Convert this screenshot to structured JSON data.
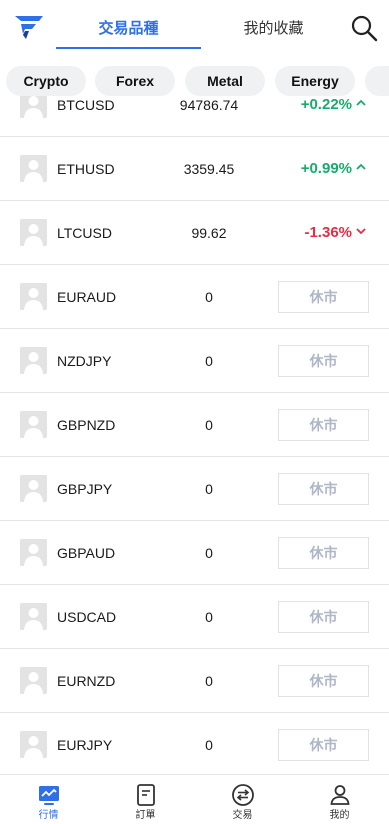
{
  "header": {
    "logo": "app-logo",
    "tabs": [
      {
        "label": "交易品種",
        "active": true
      },
      {
        "label": "我的收藏",
        "active": false
      }
    ],
    "search_icon": "search-icon"
  },
  "categories": [
    "Crypto",
    "Forex",
    "Metal",
    "Energy",
    ""
  ],
  "rows": [
    {
      "symbol": "BTCUSD",
      "price": "94786.74",
      "change": "+0.22%",
      "direction": "up"
    },
    {
      "symbol": "ETHUSD",
      "price": "3359.45",
      "change": "+0.99%",
      "direction": "up"
    },
    {
      "symbol": "LTCUSD",
      "price": "99.62",
      "change": "-1.36%",
      "direction": "down"
    },
    {
      "symbol": "EURAUD",
      "price": "0",
      "status": "休市"
    },
    {
      "symbol": "NZDJPY",
      "price": "0",
      "status": "休市"
    },
    {
      "symbol": "GBPNZD",
      "price": "0",
      "status": "休市"
    },
    {
      "symbol": "GBPJPY",
      "price": "0",
      "status": "休市"
    },
    {
      "symbol": "GBPAUD",
      "price": "0",
      "status": "休市"
    },
    {
      "symbol": "USDCAD",
      "price": "0",
      "status": "休市"
    },
    {
      "symbol": "EURNZD",
      "price": "0",
      "status": "休市"
    },
    {
      "symbol": "EURJPY",
      "price": "0",
      "status": "休市"
    }
  ],
  "bottom_nav": [
    {
      "label": "行情",
      "icon": "market-chart-icon",
      "active": true
    },
    {
      "label": "訂單",
      "icon": "order-document-icon",
      "active": false
    },
    {
      "label": "交易",
      "icon": "exchange-arrows-icon",
      "active": false
    },
    {
      "label": "我的",
      "icon": "user-profile-icon",
      "active": false
    }
  ],
  "colors": {
    "accent": "#2f6fe8",
    "up": "#1aab6c",
    "down": "#ea2b43",
    "closed_text": "#aeb6c8",
    "chip_bg": "#f0f1f3"
  }
}
